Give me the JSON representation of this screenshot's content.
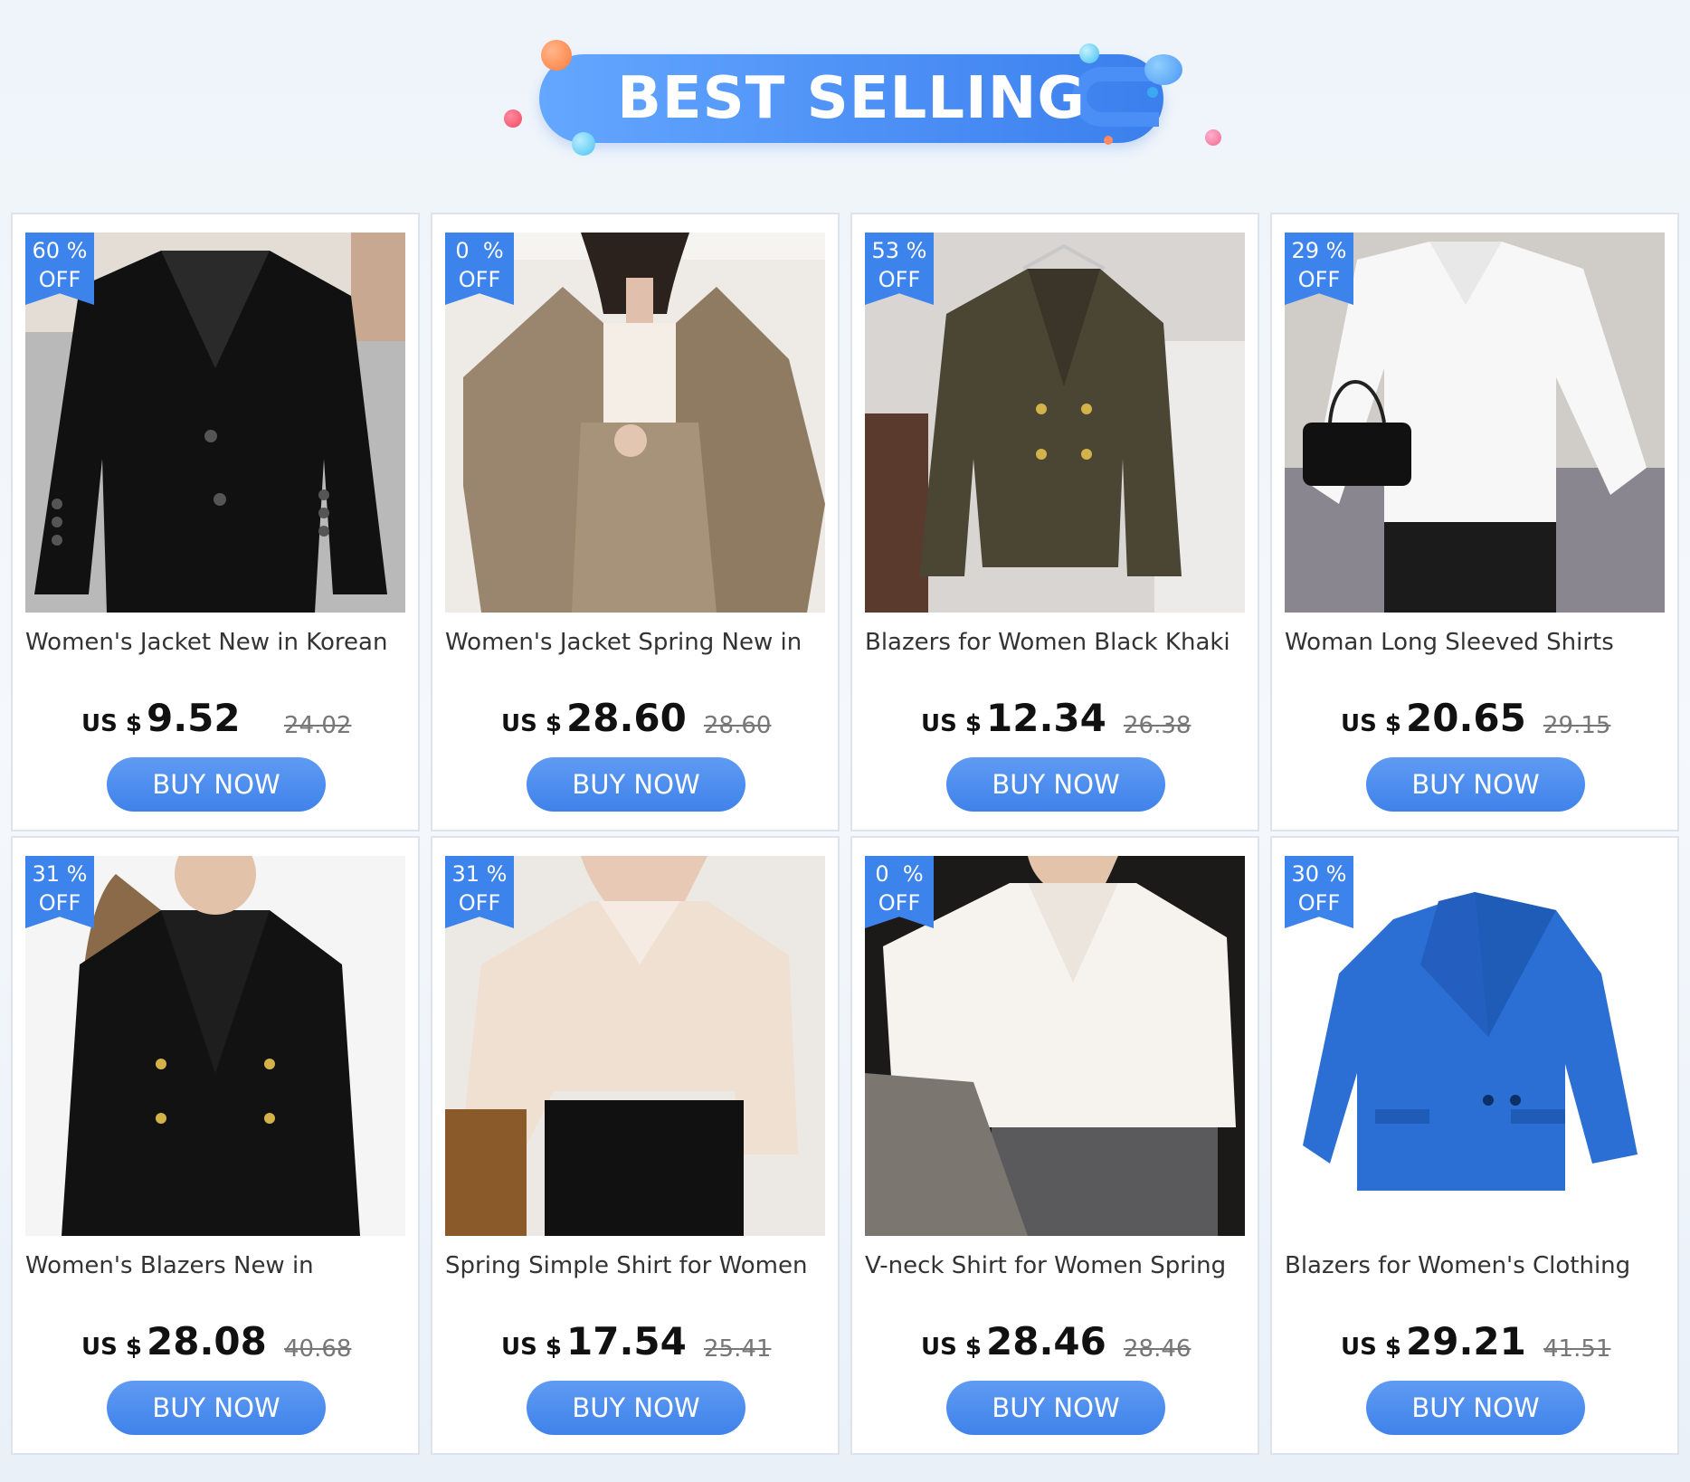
{
  "banner": {
    "title": "BEST SELLING"
  },
  "products": [
    {
      "discount": "60 %",
      "off": "OFF",
      "title": "Women's Jacket New in Korean",
      "currency": "US $",
      "price": "9.52",
      "old_price": "24.02",
      "buy": "BUY NOW"
    },
    {
      "discount": "0  %",
      "off": "OFF",
      "title": "Women's Jacket Spring New in",
      "currency": "US $",
      "price": "28.60",
      "old_price": "28.60",
      "buy": "BUY NOW"
    },
    {
      "discount": "53 %",
      "off": "OFF",
      "title": "Blazers for Women Black Khaki",
      "currency": "US $",
      "price": "12.34",
      "old_price": "26.38",
      "buy": "BUY NOW"
    },
    {
      "discount": "29 %",
      "off": "OFF",
      "title": "Woman Long Sleeved Shirts",
      "currency": "US $",
      "price": "20.65",
      "old_price": "29.15",
      "buy": "BUY NOW"
    },
    {
      "discount": "31 %",
      "off": "OFF",
      "title": "Women's Blazers New in",
      "currency": "US $",
      "price": "28.08",
      "old_price": "40.68",
      "buy": "BUY NOW"
    },
    {
      "discount": "31 %",
      "off": "OFF",
      "title": "Spring Simple Shirt for Women",
      "currency": "US $",
      "price": "17.54",
      "old_price": "25.41",
      "buy": "BUY NOW"
    },
    {
      "discount": "0  %",
      "off": "OFF",
      "title": "V-neck Shirt for Women Spring",
      "currency": "US $",
      "price": "28.46",
      "old_price": "28.46",
      "buy": "BUY NOW"
    },
    {
      "discount": "30 %",
      "off": "OFF",
      "title": "Blazers for Women's Clothing",
      "currency": "US $",
      "price": "29.21",
      "old_price": "41.51",
      "buy": "BUY NOW"
    }
  ],
  "colors": {
    "accent": "#3c83ec",
    "button": "#4a8cee"
  }
}
